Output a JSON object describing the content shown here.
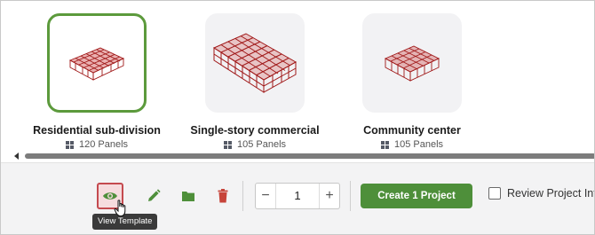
{
  "templates": [
    {
      "name": "Residential sub-division",
      "panels": "120 Panels",
      "selected": true
    },
    {
      "name": "Single-story commercial",
      "panels": "105 Panels",
      "selected": false
    },
    {
      "name": "Community center",
      "panels": "105 Panels",
      "selected": false
    }
  ],
  "toolbar": {
    "quantity": "1",
    "minus_label": "−",
    "plus_label": "+",
    "create_label": "Create 1 Project",
    "review_label": "Review Project Info",
    "review_checked": false
  },
  "tooltip": {
    "text": "View Template"
  },
  "colors": {
    "accent_green": "#4e8f3a",
    "selected_border": "#5c9a3c",
    "active_outline": "#c44a4f",
    "delete_red": "#c7443a",
    "model_red": "#a01818"
  },
  "icons": [
    "eye-icon",
    "pencil-icon",
    "folder-icon",
    "trash-icon",
    "panels-grid-icon",
    "cursor-hand-icon"
  ]
}
